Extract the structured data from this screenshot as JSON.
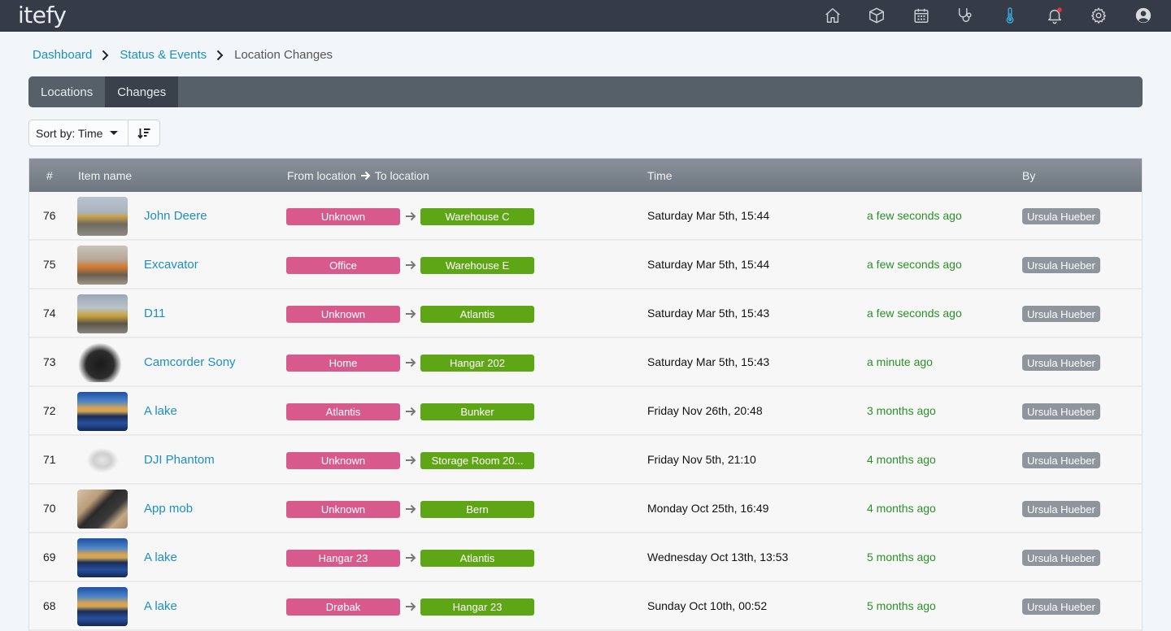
{
  "app": {
    "logo": "itefy"
  },
  "topnav": {
    "icons": [
      {
        "name": "home-icon"
      },
      {
        "name": "box-icon"
      },
      {
        "name": "calendar-icon"
      },
      {
        "name": "stethoscope-icon"
      },
      {
        "name": "thermometer-icon",
        "active": true
      },
      {
        "name": "bell-icon",
        "has_notification": true
      },
      {
        "name": "gear-icon"
      },
      {
        "name": "user-avatar-icon"
      }
    ],
    "accent_color": "#3aa6d8",
    "notification_color": "#e8323c"
  },
  "breadcrumb": {
    "items": [
      "Dashboard",
      "Status & Events"
    ],
    "current": "Location Changes"
  },
  "tabs": [
    {
      "label": "Locations",
      "active": false
    },
    {
      "label": "Changes",
      "active": true
    }
  ],
  "sort": {
    "label": "Sort by: Time"
  },
  "table": {
    "headers": {
      "num": "#",
      "item": "Item name",
      "from_to_from": "From location",
      "from_to_to": "To location",
      "time": "Time",
      "by": "By"
    },
    "rows": [
      {
        "num": "76",
        "item": "John Deere",
        "thumb": "excavator",
        "from": "Unknown",
        "to": "Warehouse C",
        "time": "Saturday Mar 5th, 15:44",
        "relative": "a few seconds ago",
        "by": "Ursula Hueber"
      },
      {
        "num": "75",
        "item": "Excavator",
        "thumb": "excavator-orange",
        "from": "Office",
        "to": "Warehouse E",
        "time": "Saturday Mar 5th, 15:44",
        "relative": "a few seconds ago",
        "by": "Ursula Hueber"
      },
      {
        "num": "74",
        "item": "D11",
        "thumb": "bulldozer",
        "from": "Unknown",
        "to": "Atlantis",
        "time": "Saturday Mar 5th, 15:43",
        "relative": "a few seconds ago",
        "by": "Ursula Hueber"
      },
      {
        "num": "73",
        "item": "Camcorder Sony",
        "thumb": "camcorder",
        "from": "Home",
        "to": "Hangar 202",
        "time": "Saturday Mar 5th, 15:43",
        "relative": "a minute ago",
        "by": "Ursula Hueber"
      },
      {
        "num": "72",
        "item": "A lake",
        "thumb": "lake",
        "from": "Atlantis",
        "to": "Bunker",
        "time": "Friday Nov 26th, 20:48",
        "relative": "3 months ago",
        "by": "Ursula Hueber"
      },
      {
        "num": "71",
        "item": "DJI Phantom",
        "thumb": "drone",
        "from": "Unknown",
        "to": "Storage Room 20...",
        "time": "Friday Nov 5th, 21:10",
        "relative": "4 months ago",
        "by": "Ursula Hueber"
      },
      {
        "num": "70",
        "item": "App mob",
        "thumb": "box",
        "from": "Unknown",
        "to": "Bern",
        "time": "Monday Oct 25th, 16:49",
        "relative": "4 months ago",
        "by": "Ursula Hueber"
      },
      {
        "num": "69",
        "item": "A lake",
        "thumb": "lake",
        "from": "Hangar 23",
        "to": "Atlantis",
        "time": "Wednesday Oct 13th, 13:53",
        "relative": "5 months ago",
        "by": "Ursula Hueber"
      },
      {
        "num": "68",
        "item": "A lake",
        "thumb": "lake",
        "from": "Drøbak",
        "to": "Hangar 23",
        "time": "Sunday Oct 10th, 00:52",
        "relative": "5 months ago",
        "by": "Ursula Hueber"
      }
    ]
  },
  "colors": {
    "from_pill": "#d85a8c",
    "to_pill": "#5ea616",
    "relative_time": "#2a9126",
    "link": "#1e8fc0"
  }
}
